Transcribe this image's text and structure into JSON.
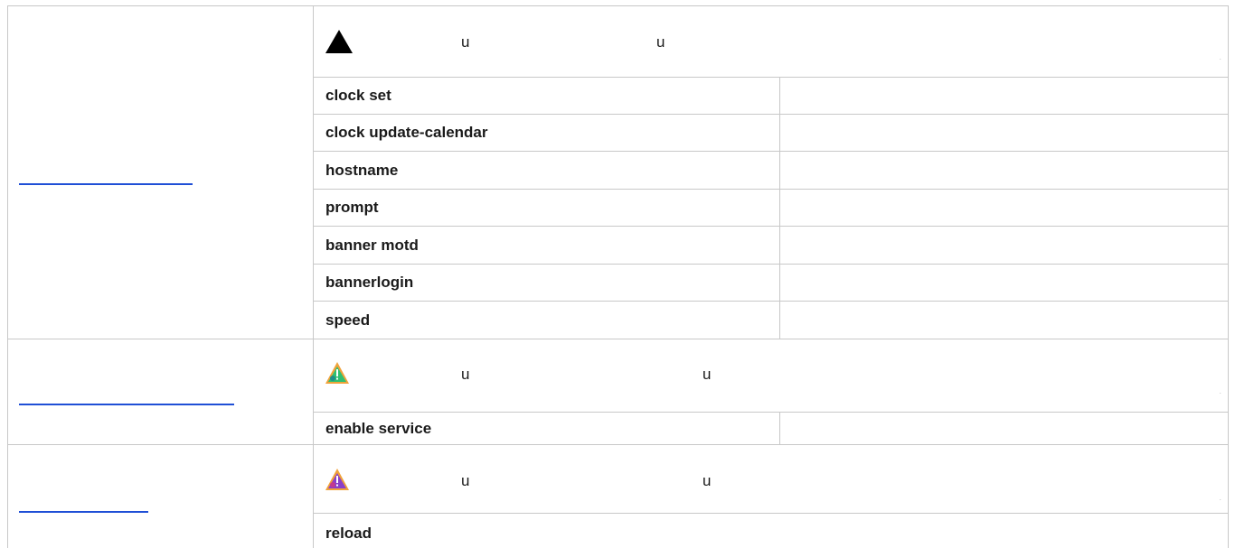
{
  "sections": [
    {
      "name": "section-1",
      "note_icon": "warning-triangle-black-icon",
      "note_marks": [
        "u",
        "u"
      ],
      "note_end_mark": ".",
      "commands": [
        "clock set",
        "clock update-calendar",
        "hostname",
        "prompt",
        "banner motd",
        "bannerlogin",
        "speed"
      ]
    },
    {
      "name": "section-2",
      "note_icon": "colored-warning-triangle-green-icon",
      "note_marks": [
        "u",
        "u"
      ],
      "note_end_mark": ".",
      "commands": [
        "enable service"
      ]
    },
    {
      "name": "section-3",
      "note_icon": "colored-warning-triangle-purple-icon",
      "note_marks": [
        "u",
        "u"
      ],
      "note_end_mark": ".",
      "commands": [
        "reload"
      ]
    }
  ],
  "colors": {
    "link": "#1f4fd6",
    "border": "#c8c8c8",
    "text": "#1a1a1a"
  }
}
